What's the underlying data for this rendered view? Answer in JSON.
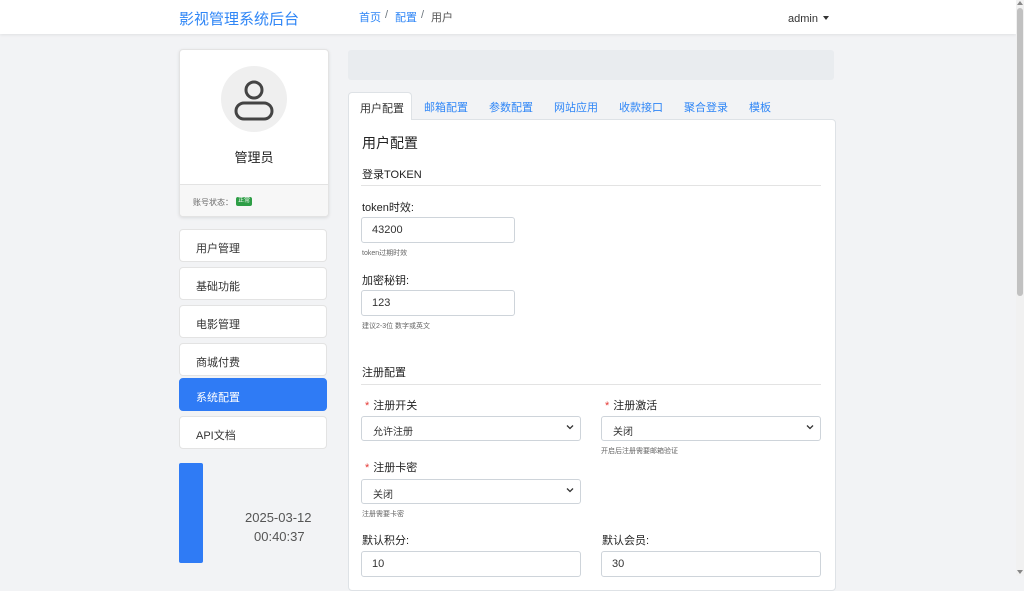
{
  "header": {
    "brand": "影视管理系统后台",
    "user": "admin"
  },
  "profile": {
    "role": "管理员",
    "status_label": "账号状态：",
    "status_badge": "正常"
  },
  "menu": [
    {
      "label": "用户管理",
      "active": false
    },
    {
      "label": "基础功能",
      "active": false
    },
    {
      "label": "电影管理",
      "active": false
    },
    {
      "label": "商城付费",
      "active": false
    },
    {
      "label": "系统配置",
      "active": true
    },
    {
      "label": "API文档",
      "active": false
    }
  ],
  "clock": {
    "date": "2025-03-12",
    "time": "00:40:37"
  },
  "breadcrumb": {
    "home": "首页",
    "config": "配置",
    "current": "用户",
    "separator": "/"
  },
  "tabs": [
    "用户配置",
    "邮箱配置",
    "参数配置",
    "网站应用",
    "收款接口",
    "聚合登录",
    "模板"
  ],
  "panel": {
    "title": "用户配置",
    "login_section": "登录TOKEN",
    "token_label": "token时效:",
    "token_value": "43200",
    "token_hint": "token过期时效",
    "secret_label": "加密秘钥:",
    "secret_value": "123",
    "secret_hint": "建议2-3位 数字或英文",
    "register_section": "注册配置",
    "register_switch_label": "注册开关",
    "register_switch_value": "允许注册",
    "register_activate_label": "注册激活",
    "register_activate_value": "关闭",
    "register_activate_hint": "开启后注册需要邮箱验证",
    "register_card_label": "注册卡密",
    "register_card_value": "关闭",
    "register_card_hint": "注册需要卡密",
    "default_points_label": "默认积分:",
    "default_points_value": "10",
    "default_member_label": "默认会员:",
    "default_member_value": "30",
    "required_mark": "*"
  },
  "colors": {
    "accent": "#2f7bf5",
    "link": "#2f86f6",
    "badge": "#2e9e46",
    "required": "#e53935"
  },
  "icons": {
    "avatar": "user-avatar-icon",
    "dropdown": "caret-down-icon",
    "select": "chevron-down-icon"
  }
}
